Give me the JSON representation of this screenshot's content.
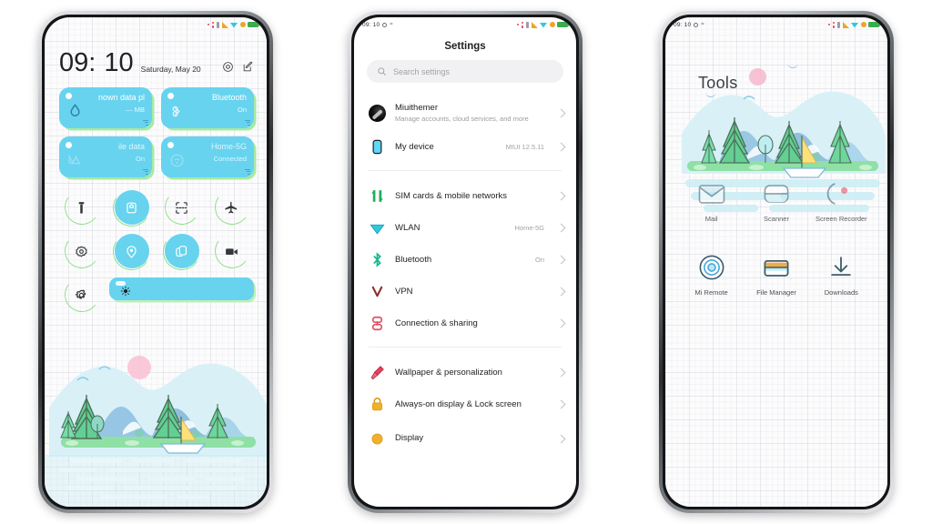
{
  "page": {
    "background": "#ffffff",
    "accent": "#67d3ef",
    "shadow_accent": "#8fe086"
  },
  "phone1": {
    "name": "quick-settings-panel",
    "statusbar": {
      "time": "09: 10",
      "icons": [
        "share-icon",
        "vibrate-icon",
        "signal-icon",
        "wifi-icon",
        "alarm-icon",
        "battery-icon"
      ]
    },
    "clock": {
      "time": "09: 10",
      "colon": ":",
      "hours": "09",
      "minutes": "10",
      "date": "Saturday, May 20"
    },
    "clock_actions": [
      {
        "name": "settings-gear-icon",
        "label": "Settings"
      },
      {
        "name": "edit-icon",
        "label": "Edit"
      }
    ],
    "tiles": [
      {
        "name": "data-usage-tile",
        "title": "nown data pl",
        "sub": "— MB",
        "icon": "water-drop-icon",
        "state": "on"
      },
      {
        "name": "bluetooth-tile",
        "title": "Bluetooth",
        "sub": "On",
        "icon": "bluetooth-icon",
        "state": "on"
      },
      {
        "name": "mobile-data-tile",
        "title": "ile data",
        "sub": "On",
        "icon": "mobile-data-icon",
        "state": "on"
      },
      {
        "name": "wifi-tile",
        "title": "Home-5G",
        "sub": "Connected",
        "icon": "wifi-round-icon",
        "state": "on"
      }
    ],
    "toggles": [
      {
        "name": "flashlight-toggle",
        "icon": "flashlight-icon",
        "state": "off"
      },
      {
        "name": "silent-toggle",
        "icon": "bell-icon",
        "state": "on"
      },
      {
        "name": "screenshot-toggle",
        "icon": "screenshot-icon",
        "state": "off"
      },
      {
        "name": "airplane-toggle",
        "icon": "airplane-icon",
        "state": "off"
      },
      {
        "name": "sync-toggle",
        "icon": "sync-icon",
        "state": "off"
      },
      {
        "name": "location-toggle",
        "icon": "location-pin-icon",
        "state": "on"
      },
      {
        "name": "cast-toggle",
        "icon": "cast-icon",
        "state": "on"
      },
      {
        "name": "screen-record-toggle",
        "icon": "video-camera-icon",
        "state": "off"
      },
      {
        "name": "settings-toggle",
        "icon": "gear-icon",
        "state": "off"
      }
    ],
    "brightness": {
      "name": "brightness-slider",
      "icon": "brightness-sun-icon",
      "value": 100
    }
  },
  "phone2": {
    "name": "settings-screen",
    "statusbar": {
      "time": "09: 10"
    },
    "title": "Settings",
    "search": {
      "placeholder": "Search settings",
      "icon": "search-icon"
    },
    "groups": [
      {
        "items": [
          {
            "name": "account-row",
            "icon": "user-avatar",
            "label": "Miuithemer",
            "desc": "Manage accounts, cloud services, and more",
            "value": ""
          },
          {
            "name": "my-device-row",
            "icon": "phone-icon",
            "label": "My device",
            "desc": "",
            "value": "MIUI 12.5.11"
          }
        ]
      },
      {
        "items": [
          {
            "name": "sim-cards-row",
            "icon": "sim-icon",
            "label": "SIM cards & mobile networks",
            "desc": "",
            "value": ""
          },
          {
            "name": "wlan-row",
            "icon": "wlan-icon",
            "label": "WLAN",
            "desc": "",
            "value": "Home-5G"
          },
          {
            "name": "bluetooth-row",
            "icon": "bluetooth-icon",
            "label": "Bluetooth",
            "desc": "",
            "value": "On"
          },
          {
            "name": "vpn-row",
            "icon": "vpn-icon",
            "label": "VPN",
            "desc": "",
            "value": ""
          },
          {
            "name": "connection-sharing-row",
            "icon": "connection-icon",
            "label": "Connection & sharing",
            "desc": "",
            "value": ""
          }
        ]
      },
      {
        "items": [
          {
            "name": "wallpaper-row",
            "icon": "brush-icon",
            "label": "Wallpaper & personalization",
            "desc": "",
            "value": ""
          },
          {
            "name": "lock-screen-row",
            "icon": "lock-icon",
            "label": "Always-on display & Lock screen",
            "desc": "",
            "value": ""
          },
          {
            "name": "display-row",
            "icon": "display-icon",
            "label": "Display",
            "desc": "",
            "value": ""
          }
        ]
      }
    ]
  },
  "phone3": {
    "name": "tools-folder-screen",
    "statusbar": {
      "time": "09: 10"
    },
    "folder_title": "Tools",
    "apps_row1": [
      {
        "name": "app-mail",
        "label": "Mail",
        "icon": "mail-icon"
      },
      {
        "name": "app-scanner",
        "label": "Scanner",
        "icon": "scanner-icon"
      },
      {
        "name": "app-screen-recorder",
        "label": "Screen Recorder",
        "icon": "screen-recorder-icon"
      }
    ],
    "apps_row2": [
      {
        "name": "app-mi-remote",
        "label": "Mi Remote",
        "icon": "mi-remote-icon"
      },
      {
        "name": "app-file-manager",
        "label": "File Manager",
        "icon": "folder-icon"
      },
      {
        "name": "app-downloads",
        "label": "Downloads",
        "icon": "download-icon"
      }
    ]
  }
}
